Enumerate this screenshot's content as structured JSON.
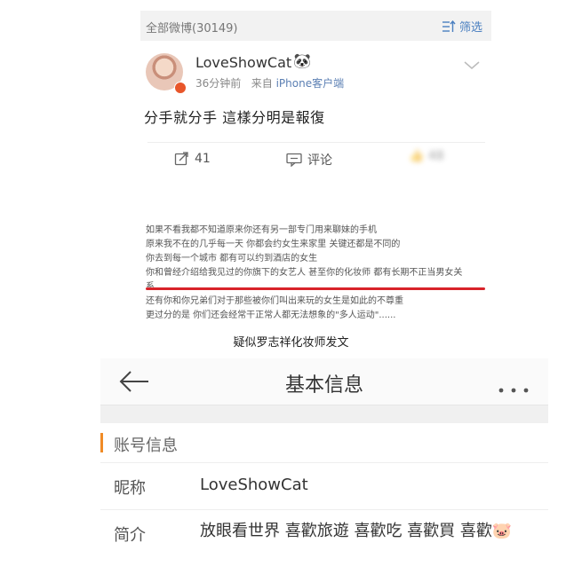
{
  "weibo": {
    "header_label": "全部微博(30149)",
    "filter_label": "筛选",
    "username": "LoveShowCat",
    "username_badge": "🐼",
    "time_text": "36分钟前",
    "from_text": "来自",
    "source_text": "iPhone客户端",
    "post_text": "分手就分手 這樣分明是報復",
    "repost_count": "41",
    "comment_label": "评论",
    "like_count": "48"
  },
  "note": {
    "lines": [
      "如果不看我都不知道原来你还有另一部专门用来聊妹的手机",
      "原来我不在的几乎每一天 你都会约女生来家里 关键还都是不同的",
      "你去到每一个城市 都有可以约到酒店的女生",
      "你和曾经介绍给我见过的你旗下的女艺人 甚至你的化妆师 都有长期不正当男女关",
      "系",
      "还有你和你兄弟们对于那些被你们叫出来玩的女生是如此的不尊重",
      "更过分的是 你们还会经常干正常人都无法想象的\"多人运动\"......"
    ]
  },
  "caption": "疑似罗志祥化妆师发文",
  "profile": {
    "nav_title": "基本信息",
    "section_title": "账号信息",
    "nickname_label": "昵称",
    "nickname_value": "LoveShowCat",
    "bio_label": "简介",
    "bio_value": "放眼看世界 喜歡旅遊 喜歡吃 喜歡買 喜歡🐷"
  },
  "colors": {
    "accent_orange": "#f08b26",
    "link_blue": "#4a7fc0",
    "highlight_red": "#d8232a"
  }
}
